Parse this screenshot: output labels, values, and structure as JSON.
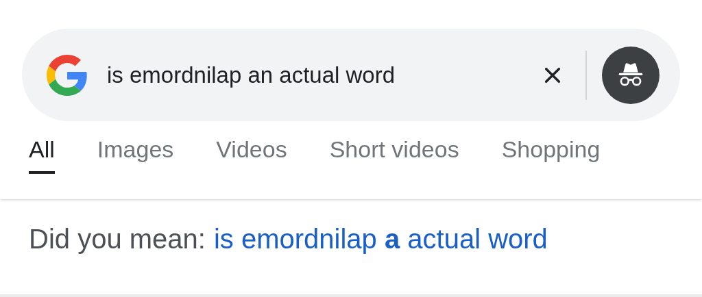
{
  "search": {
    "value": "is emordnilap an actual word"
  },
  "tabs": [
    {
      "label": "All",
      "selected": true
    },
    {
      "label": "Images",
      "selected": false
    },
    {
      "label": "Videos",
      "selected": false
    },
    {
      "label": "Short videos",
      "selected": false
    },
    {
      "label": "Shopping",
      "selected": false
    }
  ],
  "suggestion": {
    "prefix": "Did you mean:",
    "link": "is emordnilap **a** actual word"
  }
}
